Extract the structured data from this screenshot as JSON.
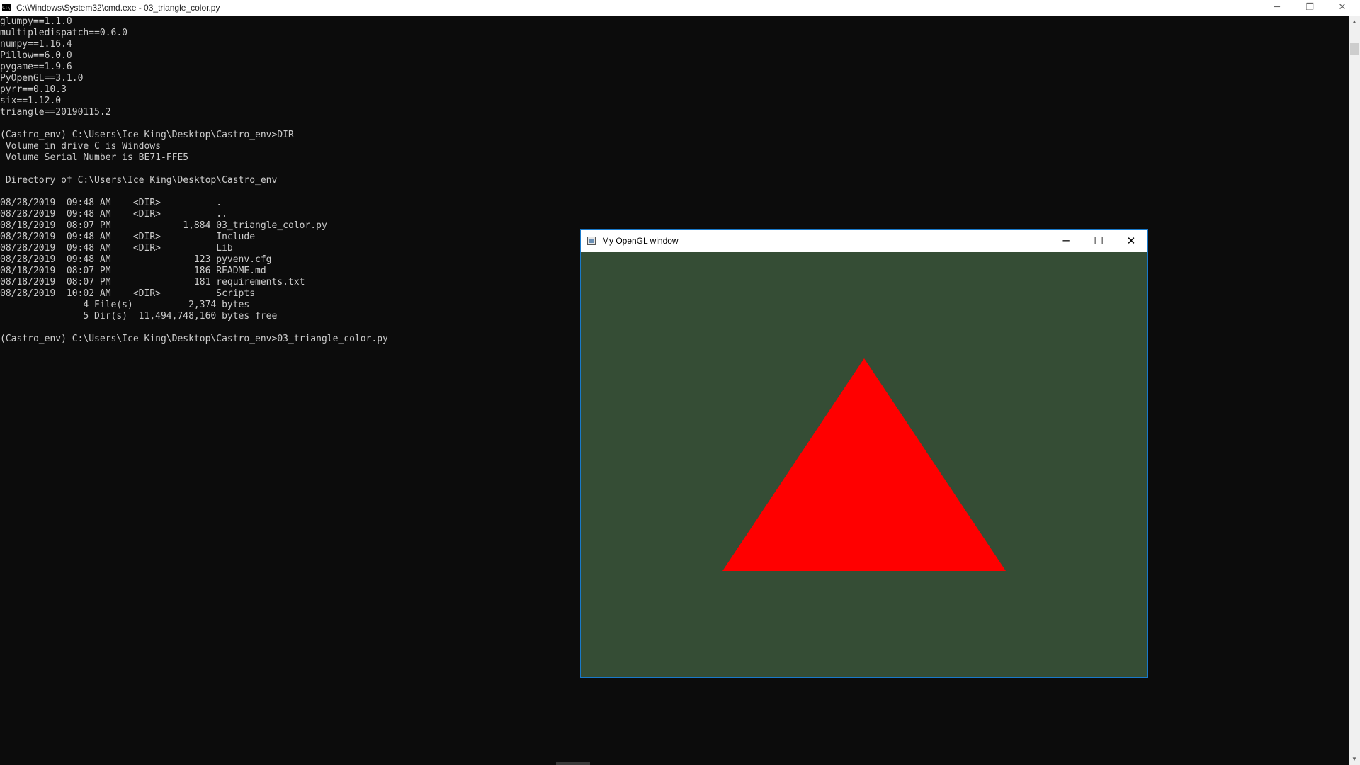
{
  "cmd_window": {
    "title": "C:\\Windows\\System32\\cmd.exe - 03_triangle_color.py",
    "icon_text": "C:\\",
    "buttons": {
      "minimize": "─",
      "restore": "❐",
      "close": "✕"
    }
  },
  "console": {
    "lines": [
      "glumpy==1.1.0",
      "multipledispatch==0.6.0",
      "numpy==1.16.4",
      "Pillow==6.0.0",
      "pygame==1.9.6",
      "PyOpenGL==3.1.0",
      "pyrr==0.10.3",
      "six==1.12.0",
      "triangle==20190115.2",
      "",
      "(Castro_env) C:\\Users\\Ice King\\Desktop\\Castro_env>DIR",
      " Volume in drive C is Windows",
      " Volume Serial Number is BE71-FFE5",
      "",
      " Directory of C:\\Users\\Ice King\\Desktop\\Castro_env",
      "",
      "08/28/2019  09:48 AM    <DIR>          .",
      "08/28/2019  09:48 AM    <DIR>          ..",
      "08/18/2019  08:07 PM             1,884 03_triangle_color.py",
      "08/28/2019  09:48 AM    <DIR>          Include",
      "08/28/2019  09:48 AM    <DIR>          Lib",
      "08/28/2019  09:48 AM               123 pyvenv.cfg",
      "08/18/2019  08:07 PM               186 README.md",
      "08/18/2019  08:07 PM               181 requirements.txt",
      "08/28/2019  10:02 AM    <DIR>          Scripts",
      "               4 File(s)          2,374 bytes",
      "               5 Dir(s)  11,494,748,160 bytes free",
      "",
      "(Castro_env) C:\\Users\\Ice King\\Desktop\\Castro_env>03_triangle_color.py"
    ]
  },
  "gl_window": {
    "title": "My OpenGL window",
    "buttons": {
      "minimize": "─",
      "maximize": "☐",
      "close": "✕"
    },
    "clear_color": "#354d35",
    "triangle_color": "#ff0000"
  },
  "colors": {
    "console_bg": "#0c0c0c",
    "console_text": "#cccccc",
    "window_border": "#1979ca"
  }
}
